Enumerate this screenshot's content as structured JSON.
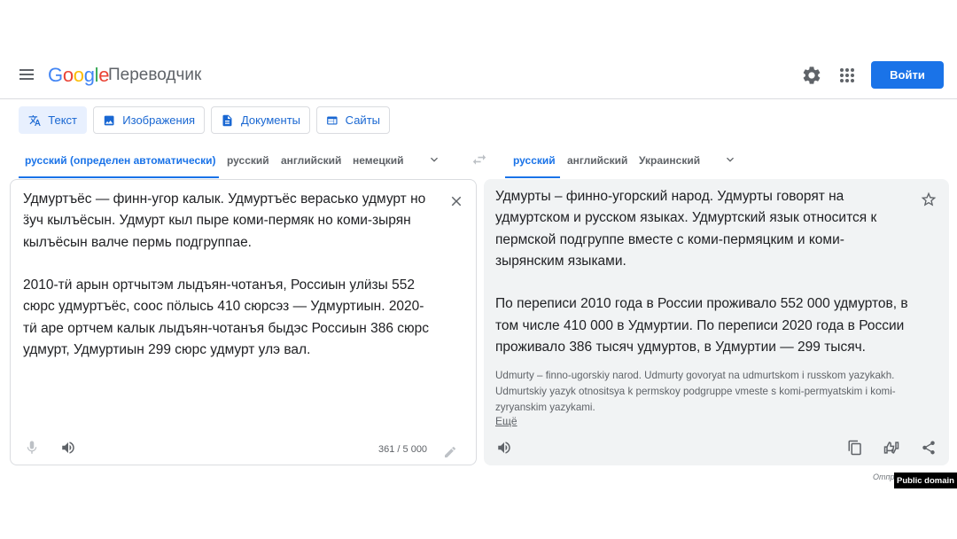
{
  "header": {
    "logo_letters": [
      "G",
      "o",
      "o",
      "g",
      "l",
      "e"
    ],
    "app_name": "Переводчик",
    "signin_label": "Войти"
  },
  "modes": [
    {
      "label": "Текст",
      "icon": "translate-icon"
    },
    {
      "label": "Изображения",
      "icon": "image-icon"
    },
    {
      "label": "Документы",
      "icon": "document-icon"
    },
    {
      "label": "Сайты",
      "icon": "web-icon"
    }
  ],
  "source_langs": [
    "русский (определен автоматически)",
    "русский",
    "английский",
    "немецкий"
  ],
  "target_langs": [
    "русский",
    "английский",
    "Украинский"
  ],
  "source": {
    "text": "Удмуртъёс — финн-угор калык. Удмуртъёс верасько удмурт но\nӟуч кылъёсын. Удмурт кыл пыре коми-пермяк но коми-зырян\nкылъёсын валче пермь подгруппае.\n\n2010-тӥ арын ортчытэм лыдъян-чотанъя, Россиын улӥзы 552\nсюрс удмуртъёс, соос пӧлысь 410 сюрсэз — Удмуртиын. 2020-\nтӥ аре ортчем калык лыдъян-чотанъя быдэс Россиын 386 сюрс\nудмурт, Удмуртиын 299 сюрс удмурт улэ вал.",
    "char_count": "361 / 5 000"
  },
  "target": {
    "text": "Удмурты – финно-угорский народ. Удмурты говорят на\nудмуртском и русском языках. Удмуртский язык относится к\nпермской подгруппе вместе с коми-пермяцким и коми-\nзырянским языками.\n\nПо переписи 2010 года в России проживало 552 000 удмуртов, в\nтом числе 410 000 в Удмуртии. По переписи 2020 года в России\nпроживало 386 тысяч удмуртов, в Удмуртии — 299 тысяч.",
    "transliteration": "Udmurty – finno-ugorskiy narod. Udmurty govoryat na udmurtskom i russkom yazykakh. Udmurtskiy yazyk otnositsya k permskoy podgruppe vmeste s komi-permyatskim i komi-zyryanskim yazykami.",
    "more_label": "Ещё"
  },
  "footer": {
    "note": "Отпр",
    "badge": "Public domain"
  },
  "colors": {
    "accent": "#1a73e8",
    "target_bg": "#f1f3f4",
    "tab_active_bg": "#e8f0fe"
  }
}
